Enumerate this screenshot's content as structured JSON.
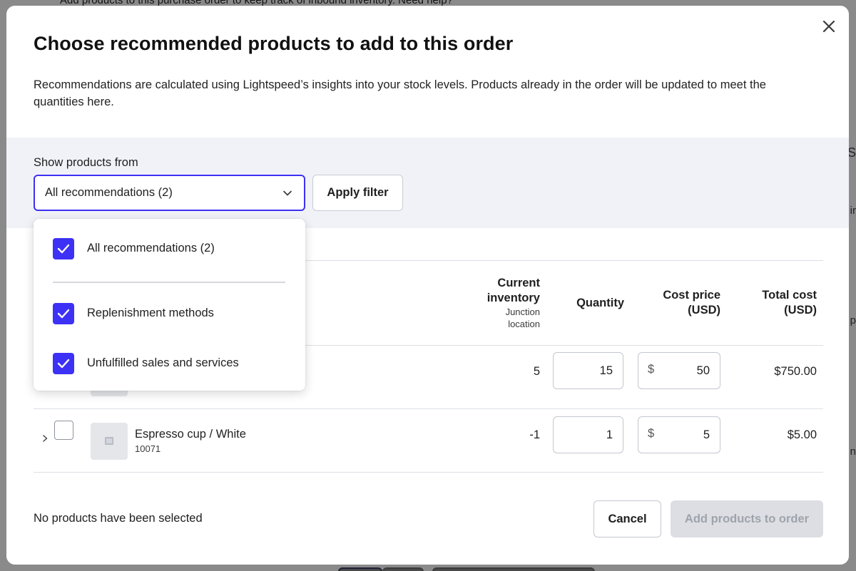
{
  "background": {
    "top_text": "Add products to this purchase order to keep track of inbound inventory. Need help?"
  },
  "modal": {
    "title": "Choose recommended products to add to this order",
    "description": "Recommendations are calculated using Lightspeed’s insights into your stock levels. Products already in the order will be updated to meet the quantities here.",
    "close_icon": "close-icon"
  },
  "filter": {
    "label": "Show products from",
    "selected": "All recommendations (2)",
    "apply_label": "Apply filter",
    "options": [
      {
        "label": "All recommendations (2)",
        "checked": true
      },
      {
        "label": "Replenishment methods",
        "checked": true
      },
      {
        "label": "Unfulfilled sales and services",
        "checked": true
      }
    ]
  },
  "table": {
    "headers": {
      "current_inventory": "Current inventory",
      "current_inventory_sub": "Junction location",
      "quantity": "Quantity",
      "cost_price": "Cost price (USD)",
      "total_cost": "Total cost (USD)"
    },
    "rows": [
      {
        "name": "",
        "sku": "",
        "inventory": "5",
        "quantity": "15",
        "currency": "$",
        "cost": "50",
        "total": "$750.00",
        "selected": false
      },
      {
        "name": "Espresso cup / White",
        "sku": "10071",
        "inventory": "-1",
        "quantity": "1",
        "currency": "$",
        "cost": "5",
        "total": "$5.00",
        "selected": false
      }
    ]
  },
  "footer": {
    "status": "No products have been selected",
    "cancel_label": "Cancel",
    "add_label": "Add products to order"
  },
  "colors": {
    "accent": "#3d31f5",
    "disabled_bg": "#dcdee3",
    "disabled_text": "#9fa3ab",
    "filter_band": "#f0f2f8"
  }
}
